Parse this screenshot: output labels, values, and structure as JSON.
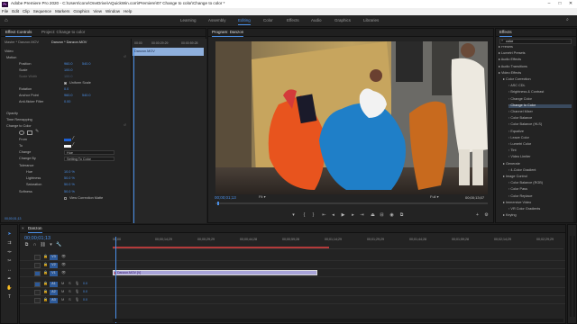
{
  "titlebar": {
    "app_logo": "Pr",
    "title": "Adobe Premiere Pro 2020 - C:\\Users\\conv\\OneDrive\\AQuickWin.com\\Premiere\\07 Change to color\\Change to color *"
  },
  "menubar": {
    "items": [
      "File",
      "Edit",
      "Clip",
      "Sequence",
      "Markers",
      "Graphics",
      "View",
      "Window",
      "Help"
    ]
  },
  "workspace": {
    "tabs": [
      "Learning",
      "Assembly",
      "Editing",
      "Color",
      "Effects",
      "Audio",
      "Graphics",
      "Libraries"
    ],
    "active": "Editing"
  },
  "effect_controls": {
    "tabs": [
      "Effect Controls",
      "Project: Change to color"
    ],
    "breadcrumb": [
      "Master * Danzon.MOV",
      "Danzon * Danzon.MOV"
    ],
    "mini_timecodes": [
      "00:00",
      "00:00:29:29",
      "00:00:59:28"
    ],
    "clip_name": "Danzon.MOV",
    "section_video": "Video",
    "motion": "Motion",
    "position": "Position",
    "position_x": "960.0",
    "position_y": "540.0",
    "scale": "Scale",
    "scale_val": "100.0",
    "scale_width": "Scale Width",
    "scale_width_val": "100.0",
    "uniform_scale": "Uniform Scale",
    "rotation": "Rotation",
    "rotation_val": "0.0",
    "anchor": "Anchor Point",
    "anchor_x": "960.0",
    "anchor_y": "540.0",
    "anti_flicker": "Anti-flicker Filter",
    "anti_flicker_val": "0.00",
    "opacity": "Opacity",
    "time_remap": "Time Remapping",
    "change_to_color": "Change to Color",
    "from": "From",
    "to": "To",
    "change": "Change",
    "change_val": "Hue",
    "change_by": "Change By",
    "change_by_val": "Setting To Color",
    "tolerance": "Tolerance",
    "hue": "Hue",
    "hue_val": "10.0 %",
    "lightness": "Lightness",
    "lightness_val": "50.0 %",
    "saturation": "Saturation",
    "saturation_val": "50.0 %",
    "softness": "Softness",
    "softness_val": "50.0 %",
    "view_mask": "View Correction Matte",
    "timecode": "00;00;01;13"
  },
  "program": {
    "title": "Program: Danzon",
    "timecode": "00;00;01;13",
    "fit": "Fit",
    "quality": "Full",
    "duration": "00;00;13;07"
  },
  "effects_panel": {
    "title": "Effects",
    "search_value": "color",
    "items": [
      {
        "label": "Presets",
        "level": 1
      },
      {
        "label": "Lumetri Presets",
        "level": 1
      },
      {
        "label": "Audio Effects",
        "level": 1
      },
      {
        "label": "Audio Transitions",
        "level": 1
      },
      {
        "label": "Video Effects",
        "level": 1
      },
      {
        "label": "Color Correction",
        "level": 2
      },
      {
        "label": "ASC CDL",
        "level": 3
      },
      {
        "label": "Brightness & Contrast",
        "level": 3
      },
      {
        "label": "Change Color",
        "level": 3
      },
      {
        "label": "Change to Color",
        "level": 3,
        "selected": true
      },
      {
        "label": "Channel Mixer",
        "level": 3
      },
      {
        "label": "Color Balance",
        "level": 3
      },
      {
        "label": "Color Balance (HLS)",
        "level": 3
      },
      {
        "label": "Equalize",
        "level": 3
      },
      {
        "label": "Leave Color",
        "level": 3
      },
      {
        "label": "Lumetri Color",
        "level": 3
      },
      {
        "label": "Tint",
        "level": 3
      },
      {
        "label": "Video Limiter",
        "level": 3
      },
      {
        "label": "Generate",
        "level": 2
      },
      {
        "label": "4-Color Gradient",
        "level": 3
      },
      {
        "label": "Image Control",
        "level": 2
      },
      {
        "label": "Color Balance (RGB)",
        "level": 3
      },
      {
        "label": "Color Pass",
        "level": 3
      },
      {
        "label": "Color Replace",
        "level": 3
      },
      {
        "label": "Immersive Video",
        "level": 2
      },
      {
        "label": "VR Color Gradients",
        "level": 3
      },
      {
        "label": "Keying",
        "level": 2
      }
    ]
  },
  "timeline": {
    "sequence": "Danzon",
    "timecode": "00;00;01;13",
    "ruler": [
      "00;00",
      "00;00;14;29",
      "00;00;29;29",
      "00;00;44;28",
      "00;00;59;28",
      "00;01;14;29",
      "00;01;29;29",
      "00;01;44;28",
      "00;01;59;28",
      "00;02;14;29",
      "00;02;29;29"
    ],
    "video_tracks": [
      "V3",
      "V2",
      "V1"
    ],
    "audio_tracks": [
      "A1",
      "A2",
      "A3"
    ],
    "clip_label": "Danzon.MOV [V]",
    "audio_vol": "0.0"
  }
}
